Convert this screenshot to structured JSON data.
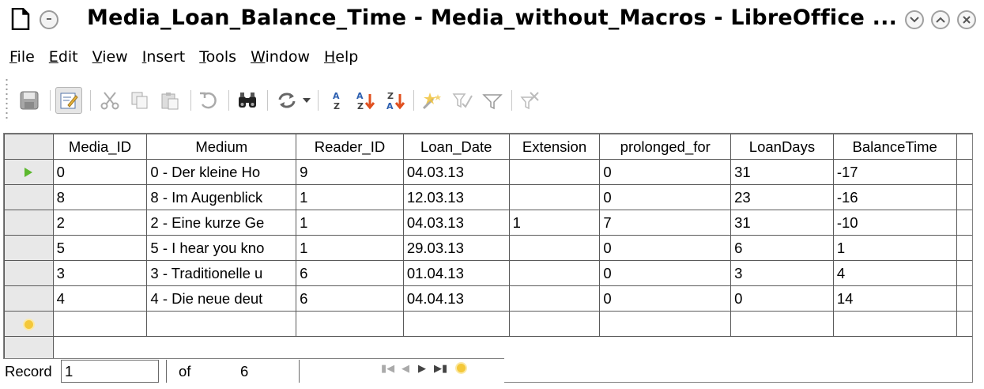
{
  "window": {
    "title": "Media_Loan_Balance_Time - Media_without_Macros - LibreOffice ...",
    "app_icon": "libreoffice-base-icon",
    "controls": [
      "window-menu-icon",
      "minimize-icon",
      "maximize-icon",
      "close-icon"
    ]
  },
  "menu": {
    "items": [
      {
        "label": "File",
        "u": "F",
        "rest": "ile"
      },
      {
        "label": "Edit",
        "u": "E",
        "rest": "dit"
      },
      {
        "label": "View",
        "u": "V",
        "rest": "iew"
      },
      {
        "label": "Insert",
        "u": "I",
        "rest": "nsert"
      },
      {
        "label": "Tools",
        "u": "T",
        "rest": "ools"
      },
      {
        "label": "Window",
        "u": "W",
        "rest": "indow"
      },
      {
        "label": "Help",
        "u": "H",
        "rest": "elp"
      }
    ]
  },
  "toolbar": {
    "icons": [
      "save-icon",
      "edit-mode-icon",
      "cut-icon",
      "copy-icon",
      "paste-icon",
      "undo-icon",
      "find-record-icon",
      "refresh-icon",
      "sort-ascending-icon",
      "sort-az-icon",
      "sort-za-icon",
      "autofilter-icon",
      "standard-filter-icon",
      "apply-filter-icon",
      "remove-filter-icon"
    ]
  },
  "table": {
    "columns": [
      "Media_ID",
      "Medium",
      "Reader_ID",
      "Loan_Date",
      "Extension",
      "prolonged_for",
      "LoanDays",
      "BalanceTime"
    ],
    "rows": [
      [
        "0",
        "0 - Der kleine Ho",
        "9",
        "04.03.13",
        "",
        "0",
        "31",
        "-17"
      ],
      [
        "8",
        "8 - Im Augenblick",
        "1",
        "12.03.13",
        "",
        "0",
        "23",
        "-16"
      ],
      [
        "2",
        "2 - Eine kurze Ge",
        "1",
        "04.03.13",
        "1",
        "7",
        "31",
        "-10"
      ],
      [
        "5",
        "5 - I hear you kno",
        "1",
        "29.03.13",
        "",
        "0",
        "6",
        "1"
      ],
      [
        "3",
        "3 - Traditionelle u",
        "6",
        "01.04.13",
        "",
        "0",
        "3",
        "4"
      ],
      [
        "4",
        "4 - Die neue deut",
        "6",
        "04.04.13",
        "",
        "0",
        "0",
        "14"
      ]
    ]
  },
  "record_bar": {
    "label": "Record",
    "current": "1",
    "of": "of",
    "total": "6"
  },
  "colors": {
    "current_row_marker": "#5cb82e",
    "new_row_marker": "#f4c83a"
  }
}
